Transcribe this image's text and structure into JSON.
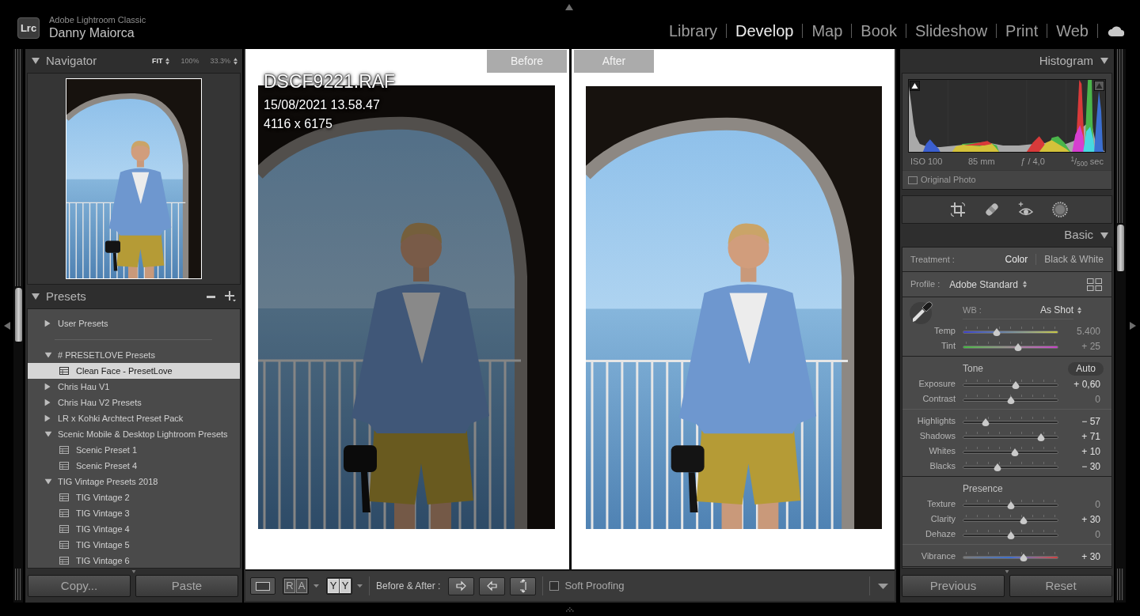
{
  "app": {
    "logo": "Lrc",
    "product": "Adobe Lightroom Classic",
    "user": "Danny Maiorca"
  },
  "modules": [
    {
      "label": "Library",
      "selected": false
    },
    {
      "label": "Develop",
      "selected": true
    },
    {
      "label": "Map",
      "selected": false
    },
    {
      "label": "Book",
      "selected": false
    },
    {
      "label": "Slideshow",
      "selected": false
    },
    {
      "label": "Print",
      "selected": false
    },
    {
      "label": "Web",
      "selected": false
    }
  ],
  "navigator": {
    "title": "Navigator",
    "expanded": true,
    "zoom_options": [
      {
        "label": "FIT",
        "selected": true,
        "kind": "stepper"
      },
      {
        "label": "100%",
        "selected": false,
        "kind": "plain"
      },
      {
        "label": "33.3%",
        "selected": false,
        "kind": "stepper"
      }
    ]
  },
  "presets": {
    "title": "Presets",
    "expanded": true,
    "folders": [
      {
        "label": "User Presets",
        "expanded": false,
        "selected": false,
        "divider_below": true
      },
      {
        "label": "# PRESETLOVE Presets",
        "expanded": true,
        "selected": false,
        "children": [
          {
            "label": "Clean Face - PresetLove",
            "selected": true
          }
        ]
      },
      {
        "label": "Chris Hau V1",
        "expanded": false,
        "selected": false
      },
      {
        "label": "Chris Hau V2 Presets",
        "expanded": false,
        "selected": false
      },
      {
        "label": "LR x Kohki Archtect Preset Pack",
        "expanded": false,
        "selected": false
      },
      {
        "label": "Scenic Mobile & Desktop Lightroom Presets",
        "expanded": true,
        "selected": false,
        "children": [
          {
            "label": "Scenic Preset 1",
            "selected": false
          },
          {
            "label": "Scenic Preset 4",
            "selected": false
          }
        ]
      },
      {
        "label": "TIG Vintage Presets 2018",
        "expanded": true,
        "selected": false,
        "children": [
          {
            "label": "TIG Vintage 2",
            "selected": false
          },
          {
            "label": "TIG Vintage 3",
            "selected": false
          },
          {
            "label": "TIG Vintage 4",
            "selected": false
          },
          {
            "label": "TIG Vintage 5",
            "selected": false
          },
          {
            "label": "TIG Vintage 6",
            "selected": false
          }
        ]
      }
    ]
  },
  "left_buttons": [
    "Copy...",
    "Paste"
  ],
  "compare": {
    "panes": [
      {
        "kind": "before",
        "label": "Before",
        "info": {
          "filename": "DSCF9221.RAF",
          "capture_time": "15/08/2021 13.58.47",
          "dimensions": "4116 x 6175"
        }
      },
      {
        "kind": "after",
        "label": "After"
      }
    ]
  },
  "toolbar": {
    "view_modes": [
      {
        "kind": "loupe",
        "selected": false
      },
      {
        "kind": "split",
        "glyphs": [
          "R",
          "A"
        ],
        "selected": false,
        "menu": true
      },
      {
        "kind": "split",
        "glyphs": [
          "Y",
          "Y"
        ],
        "selected": true,
        "menu": true
      }
    ],
    "label": "Before & After :",
    "actions": [
      {
        "kind": "copy_right"
      },
      {
        "kind": "copy_left"
      },
      {
        "kind": "swap"
      }
    ],
    "soft_proofing": {
      "label": "Soft Proofing",
      "checked": false
    }
  },
  "histogram": {
    "title": "Histogram",
    "expanded": true,
    "clipping": [
      {
        "kind": "shadows",
        "lit": true
      },
      {
        "kind": "highlights",
        "lit": false
      }
    ],
    "info": [
      "ISO 100",
      "85 mm",
      "ƒ / 4,0",
      "$^{1}$/$_{500}$ sec"
    ],
    "original_photo": {
      "label": "Original Photo",
      "checked": false
    }
  },
  "tools": [
    {
      "kind": "crop"
    },
    {
      "kind": "heal"
    },
    {
      "kind": "red_eye"
    },
    {
      "kind": "masking"
    }
  ],
  "basic": {
    "title": "Basic",
    "expanded": true,
    "treatment": {
      "label": "Treatment :",
      "options": [
        {
          "label": "Color",
          "selected": true
        },
        {
          "label": "Black & White",
          "selected": false
        }
      ]
    },
    "profile": {
      "label": "Profile :",
      "value": "Adobe Standard"
    },
    "sections": [
      {
        "kind": "white_balance",
        "label": "WB :",
        "value": "As Shot",
        "sliders": [
          {
            "label": "Temp",
            "value": "5.400",
            "level": 0.355,
            "modified": false,
            "kind": "temperature"
          },
          {
            "label": "Tint",
            "value": "+ 25",
            "level": 0.58,
            "modified": false,
            "kind": "tint"
          }
        ]
      },
      {
        "kind": "titled",
        "title": "Tone",
        "action": "Auto",
        "sliders": [
          {
            "label": "Exposure",
            "value": "+ 0,60",
            "level": 0.55,
            "modified": true,
            "kind": "plain"
          },
          {
            "label": "Contrast",
            "value": "0",
            "level": 0.5,
            "modified": false,
            "kind": "plain"
          }
        ]
      },
      {
        "kind": "plain",
        "sliders": [
          {
            "label": "Highlights",
            "value": "− 57",
            "level": 0.24,
            "modified": true,
            "kind": "plain"
          },
          {
            "label": "Shadows",
            "value": "+ 71",
            "level": 0.82,
            "modified": true,
            "kind": "plain"
          },
          {
            "label": "Whites",
            "value": "+ 10",
            "level": 0.545,
            "modified": true,
            "kind": "plain"
          },
          {
            "label": "Blacks",
            "value": "− 30",
            "level": 0.36,
            "modified": true,
            "kind": "plain"
          }
        ]
      },
      {
        "kind": "titled",
        "title": "Presence",
        "sliders": [
          {
            "label": "Texture",
            "value": "0",
            "level": 0.5,
            "modified": false,
            "kind": "plain"
          },
          {
            "label": "Clarity",
            "value": "+ 30",
            "level": 0.64,
            "modified": true,
            "kind": "plain"
          },
          {
            "label": "Dehaze",
            "value": "0",
            "level": 0.5,
            "modified": false,
            "kind": "plain"
          }
        ]
      },
      {
        "kind": "plain",
        "sliders": [
          {
            "label": "Vibrance",
            "value": "+ 30",
            "level": 0.64,
            "modified": true,
            "kind": "saturation"
          }
        ]
      }
    ]
  },
  "right_buttons": [
    "Previous",
    "Reset"
  ]
}
